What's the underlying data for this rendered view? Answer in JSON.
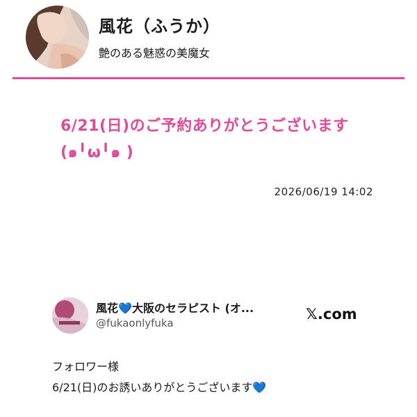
{
  "profile": {
    "name": "風花（ふうか）",
    "tagline": "艶のある魅惑の美魔女"
  },
  "post": {
    "title": "6/21(日)のご予約ありがとうございます(๑╹ω╹๑ )",
    "date": "2026/06/19 14:02"
  },
  "embed": {
    "display_name": "風花",
    "name_heart": "💙",
    "display_name_rest": "大阪のセラピスト (オ...",
    "handle": "@fukaonlyfuka",
    "brand_logo": "𝕏",
    "brand_text": ".com",
    "body_line1": "フォロワー様",
    "body_line2": "6/21(日)のお誘いありがとうございます",
    "body_heart": "💙"
  },
  "colors": {
    "accent": "#e14a99",
    "heart": "#2f7de1"
  }
}
